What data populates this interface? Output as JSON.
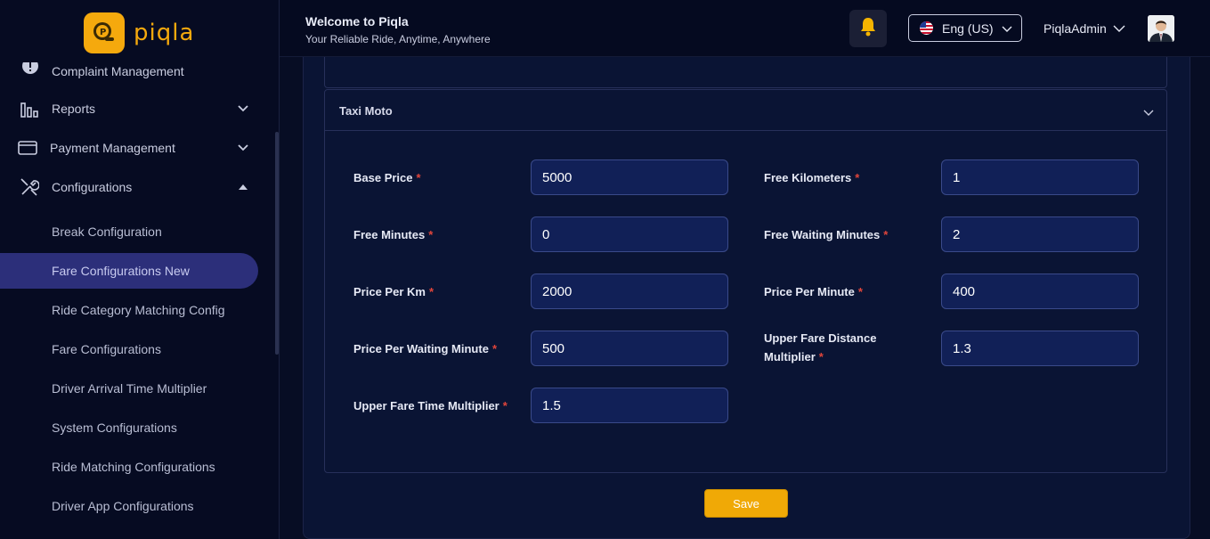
{
  "brand": {
    "name": "piqla"
  },
  "header": {
    "welcome": "Welcome to Piqla",
    "tagline": "Your Reliable Ride, Anytime, Anywhere",
    "language": "Eng (US)",
    "user_name": "PiqlaAdmin"
  },
  "sidebar": {
    "items": [
      {
        "label": "Complaint Management",
        "icon": "alert-icon"
      },
      {
        "label": "Reports",
        "icon": "bar-chart-icon"
      },
      {
        "label": "Payment Management",
        "icon": "credit-card-icon"
      },
      {
        "label": "Configurations",
        "icon": "tools-icon"
      }
    ],
    "sub_items": [
      "Break Configuration",
      "Fare Configurations New",
      "Ride Category Matching Config",
      "Fare Configurations",
      "Driver Arrival Time Multiplier",
      "System Configurations",
      "Ride Matching Configurations",
      "Driver App Configurations"
    ],
    "active_sub_item": "Fare Configurations New"
  },
  "panel": {
    "title": "Taxi Moto",
    "fields": {
      "base_price": {
        "label": "Base Price",
        "value": "5000"
      },
      "free_kilometers": {
        "label": "Free Kilometers",
        "value": "1"
      },
      "free_minutes": {
        "label": "Free Minutes",
        "value": "0"
      },
      "free_waiting_minutes": {
        "label": "Free Waiting Minutes",
        "value": "2"
      },
      "price_per_km": {
        "label": "Price Per Km",
        "value": "2000"
      },
      "price_per_minute": {
        "label": "Price Per Minute",
        "value": "400"
      },
      "price_per_waiting_minute": {
        "label": "Price Per Waiting Minute",
        "value": "500"
      },
      "upper_fare_distance_multiplier": {
        "label_line1": "Upper Fare Distance",
        "label_line2": "Multiplier",
        "value": "1.3"
      },
      "upper_fare_time_multiplier": {
        "label": "Upper Fare Time Multiplier",
        "value": "1.5"
      }
    },
    "required_marker": "*"
  },
  "actions": {
    "save_label": "Save"
  },
  "colors": {
    "accent": "#f0a906",
    "active_nav": "#2c2f7a",
    "required": "#e0453b"
  }
}
